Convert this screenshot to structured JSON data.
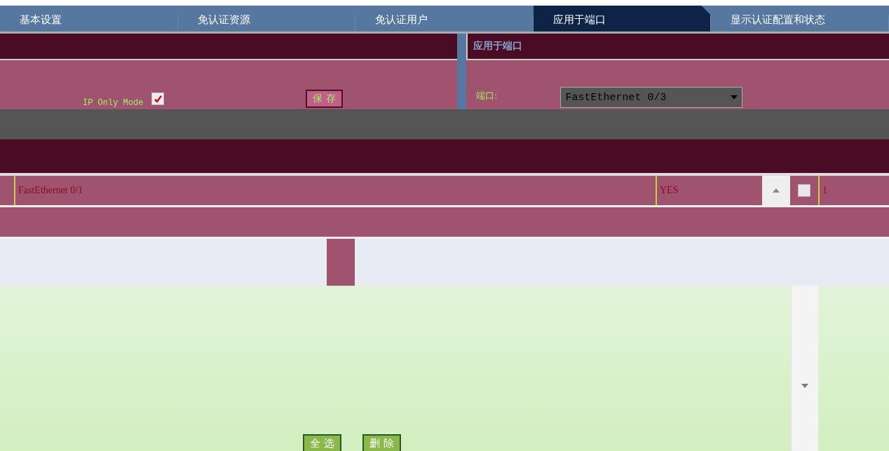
{
  "tabs": [
    {
      "label": "基本设置",
      "selected": false
    },
    {
      "label": "免认证资源",
      "selected": false
    },
    {
      "label": "免认证用户",
      "selected": false
    },
    {
      "label": "应用于端口",
      "selected": true
    },
    {
      "label": "显示认证配置和状态",
      "selected": false
    }
  ],
  "settings": {
    "option_label": "IP Only Mode",
    "checked": true,
    "save_button": "保 存"
  },
  "port_panel": {
    "title": "应用于端口",
    "port_label": "端口:",
    "port_value": "FastEthernet 0/3"
  },
  "table": {
    "rows": [
      {
        "port": "FastEthernet 0/1",
        "ip_only": "YES",
        "checked": false,
        "index": "1"
      }
    ]
  },
  "buttons": [
    "全 选",
    "删 除"
  ]
}
